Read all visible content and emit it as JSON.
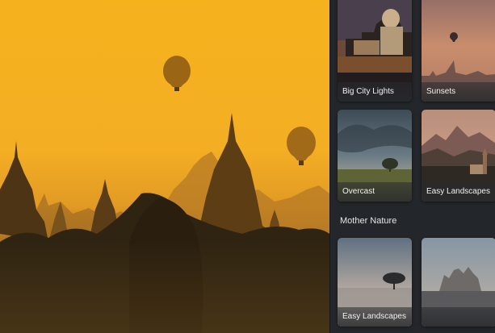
{
  "preview": {
    "image": "hot-air-balloons-over-temples-at-sunrise"
  },
  "panel": {
    "tiles": [
      {
        "label": "Big City Lights",
        "thumbnail": "city-night-dome-icon"
      },
      {
        "label": "Sunsets",
        "thumbnail": "sunset-skyline-balloon-icon"
      },
      {
        "label": "Overcast",
        "thumbnail": "overcast-field-tree-icon"
      },
      {
        "label": "Easy Landscapes",
        "thumbnail": "mountain-landscape-icon"
      }
    ],
    "section_title": "Mother Nature",
    "nature_tiles": [
      {
        "label": "Easy Landscapes",
        "thumbnail": "lone-tree-lake-icon"
      },
      {
        "label": "",
        "thumbnail": "rocky-peaks-icon"
      }
    ]
  },
  "colors": {
    "panel_bg": "#23262a",
    "sky_gold": "#f0a81c"
  }
}
